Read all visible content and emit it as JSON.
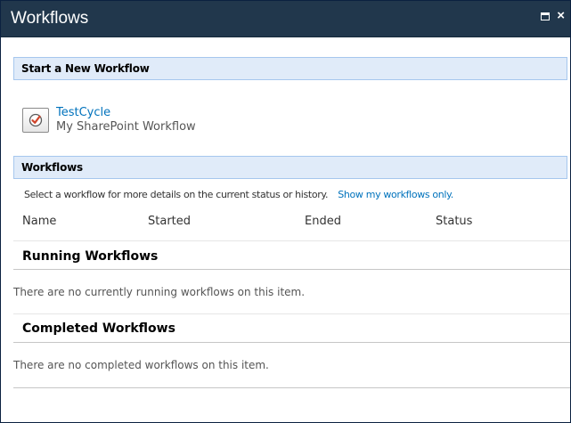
{
  "window": {
    "title": "Workflows",
    "controls": {
      "maximize": "maximize-icon",
      "close": "close-icon",
      "close_glyph": "×"
    }
  },
  "start_section": {
    "header": "Start a New Workflow",
    "workflow": {
      "name": "TestCycle",
      "description": "My SharePoint Workflow",
      "icon": "workflow-check-icon"
    }
  },
  "workflows_section": {
    "header": "Workflows",
    "info_text": "Select a workflow for more details on the current status or history.",
    "filter_link": "Show my workflows only.",
    "columns": [
      "Name",
      "Started",
      "Ended",
      "Status"
    ]
  },
  "running": {
    "title": "Running Workflows",
    "empty_message": "There are no currently running workflows on this item."
  },
  "completed": {
    "title": "Completed Workflows",
    "empty_message": "There are no completed workflows on this item."
  },
  "colors": {
    "titlebar": "#21374c",
    "header_bg": "#e0ebf9",
    "header_border": "#a6c7ee",
    "link": "#0072bc"
  }
}
